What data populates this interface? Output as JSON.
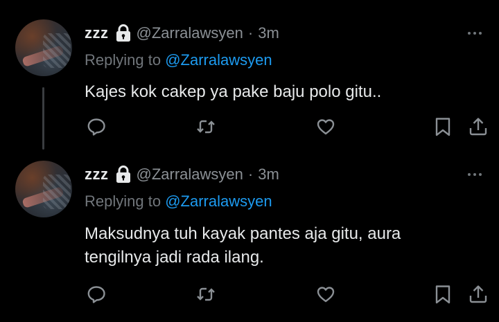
{
  "tweets": [
    {
      "name": "zzz",
      "handle": "@Zarralawsyen",
      "separator": "·",
      "time": "3m",
      "replying_prefix": "Replying to",
      "replying_to": "@Zarralawsyen",
      "text": "Kajes kok cakep ya pake baju polo gitu.."
    },
    {
      "name": "zzz",
      "handle": "@Zarralawsyen",
      "separator": "·",
      "time": "3m",
      "replying_prefix": "Replying to",
      "replying_to": "@Zarralawsyen",
      "text": "Maksudnya tuh kayak pantes aja gitu, aura tengilnya jadi rada ilang."
    }
  ],
  "colors": {
    "background": "#000000",
    "text": "#e7e9ea",
    "muted": "#71767b",
    "link": "#1d9bf0"
  },
  "icons": [
    "lock-icon",
    "more-icon",
    "reply-icon",
    "retweet-icon",
    "like-icon",
    "bookmark-icon",
    "share-icon"
  ]
}
